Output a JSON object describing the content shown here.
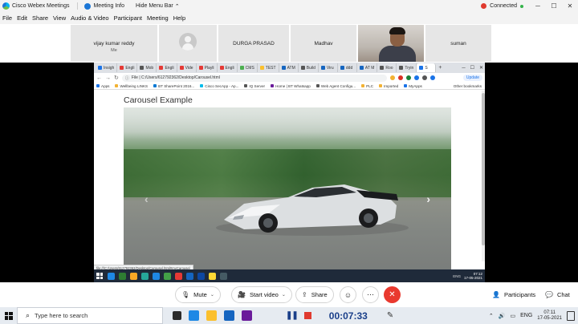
{
  "window": {
    "app_title": "Cisco Webex Meetings",
    "meeting_info": "Meeting Info",
    "hide_menu_bar": "Hide Menu Bar",
    "connection_status": "Connected"
  },
  "menu": {
    "items": [
      "File",
      "Edit",
      "Share",
      "View",
      "Audio & Video",
      "Participant",
      "Meeting",
      "Help"
    ]
  },
  "participants": [
    {
      "name": "vijay kumar reddy",
      "sub": "Me"
    },
    {
      "name": "",
      "sub": ""
    },
    {
      "name": "DURGA PRASAD",
      "sub": ""
    },
    {
      "name": "Madhav",
      "sub": ""
    },
    {
      "name": "",
      "sub": ""
    },
    {
      "name": "suman",
      "sub": ""
    }
  ],
  "browser": {
    "tabs": [
      "Insigh",
      "Engli",
      "Mob",
      "Engli",
      "Vide",
      "Playli",
      "Engli",
      "CMS",
      "TEST",
      "ATM",
      "Build",
      "Viru",
      "ddd",
      "AT M",
      "Roo",
      "Tryin",
      "S"
    ],
    "url": "File  |  C:/Users/612792362/Desktop/Carousel.html",
    "update_label": "Update",
    "bookmarks": [
      "Apps",
      "Wellbeing LINKS",
      "BT SharePoint 2016...",
      "Cisco SecApp - Ap...",
      "IQ Server",
      "Home | BT Whatsapp",
      "Web Agent Configu...",
      "PLC",
      "Imported",
      "MyApps"
    ],
    "other_bookmarks": "Other bookmarks",
    "page_title": "Carousel Example",
    "status_url": "file:///C:/Users/612792362/Desktop/Carousel.html#myCarousel",
    "clock_time": "07:12",
    "clock_date": "17-05-2021",
    "tray_lang": "ENG"
  },
  "controls": {
    "mute": "Mute",
    "start_video": "Start video",
    "share": "Share",
    "participants": "Participants",
    "chat": "Chat"
  },
  "taskbar": {
    "search_placeholder": "Type here to search",
    "recording_time": "00:07:33",
    "lang": "ENG",
    "time": "07:11",
    "date": "17-05-2021"
  },
  "colors": {
    "end_call": "#e9392f",
    "recording_time": "#1a3f8a",
    "connected_dot": "#34b34a"
  }
}
